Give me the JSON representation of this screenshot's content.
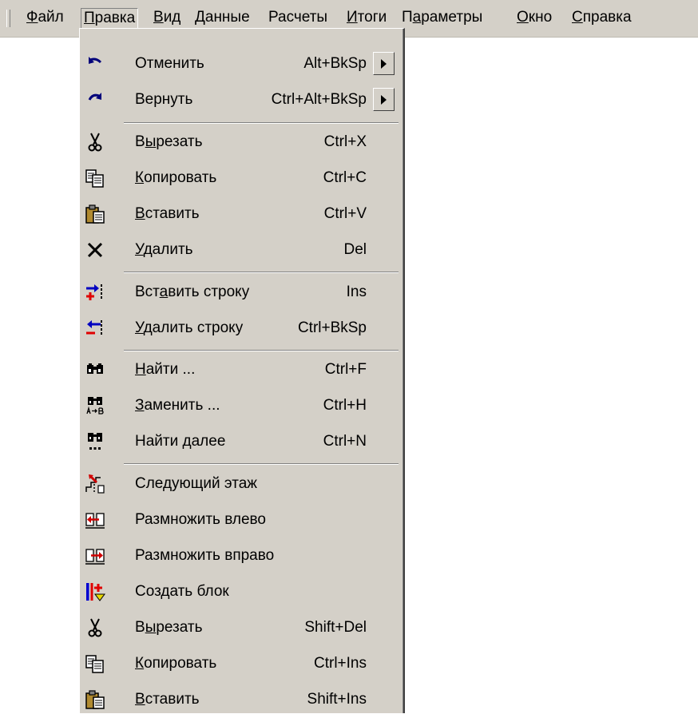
{
  "menubar": {
    "items": [
      {
        "pre": "",
        "acc": "Ф",
        "post": "айл"
      },
      {
        "pre": "",
        "acc": "П",
        "post": "равка"
      },
      {
        "pre": "",
        "acc": "В",
        "post": "ид"
      },
      {
        "pre": "",
        "acc": "Д",
        "post": "анные"
      },
      {
        "pre": "Расчеты",
        "acc": "",
        "post": ""
      },
      {
        "pre": "",
        "acc": "И",
        "post": "тоги"
      },
      {
        "pre": "П",
        "acc": "а",
        "post": "раметры"
      },
      {
        "pre": "",
        "acc": "О",
        "post": "кно"
      },
      {
        "pre": "",
        "acc": "С",
        "post": "правка"
      }
    ]
  },
  "edit_menu": {
    "items": [
      {
        "icon": "undo-icon",
        "pre": "Отменить",
        "acc": "",
        "post": "",
        "shortcut": "Alt+BkSp"
      },
      {
        "icon": "redo-icon",
        "pre": "Вернуть",
        "acc": "",
        "post": "",
        "shortcut": "Ctrl+Alt+BkSp"
      },
      {
        "icon": "scissors-icon",
        "pre": "В",
        "acc": "ы",
        "post": "резать",
        "shortcut": "Ctrl+X"
      },
      {
        "icon": "copy-icon",
        "pre": "",
        "acc": "К",
        "post": "опировать",
        "shortcut": "Ctrl+C"
      },
      {
        "icon": "paste-icon",
        "pre": "",
        "acc": "В",
        "post": "ставить",
        "shortcut": "Ctrl+V"
      },
      {
        "icon": "delete-x-icon",
        "pre": "",
        "acc": "У",
        "post": "далить",
        "shortcut": "Del"
      },
      {
        "icon": "insert-row-icon",
        "pre": "Вст",
        "acc": "а",
        "post": "вить строку",
        "shortcut": "Ins"
      },
      {
        "icon": "delete-row-icon",
        "pre": "",
        "acc": "У",
        "post": "далить строку",
        "shortcut": "Ctrl+BkSp"
      },
      {
        "icon": "binoculars-icon",
        "pre": "",
        "acc": "Н",
        "post": "айти ...",
        "shortcut": "Ctrl+F"
      },
      {
        "icon": "replace-binoculars-icon",
        "pre": "",
        "acc": "З",
        "post": "аменить ...",
        "shortcut": "Ctrl+H"
      },
      {
        "icon": "find-next-binoculars-icon",
        "pre": "Найти ",
        "acc": "д",
        "post": "алее",
        "shortcut": "Ctrl+N"
      },
      {
        "icon": "next-floor-icon",
        "pre": "Следующий этаж",
        "acc": "",
        "post": "",
        "shortcut": ""
      },
      {
        "icon": "multiply-left-icon",
        "pre": "Размножить влево",
        "acc": "",
        "post": "",
        "shortcut": ""
      },
      {
        "icon": "multiply-right-icon",
        "pre": "Размножить вправо",
        "acc": "",
        "post": "",
        "shortcut": ""
      },
      {
        "icon": "create-block-icon",
        "pre": "Создать блок",
        "acc": "",
        "post": "",
        "shortcut": ""
      },
      {
        "icon": "scissors-icon",
        "pre": "В",
        "acc": "ы",
        "post": "резать",
        "shortcut": "Shift+Del"
      },
      {
        "icon": "copy-icon",
        "pre": "",
        "acc": "К",
        "post": "опировать",
        "shortcut": "Ctrl+Ins"
      },
      {
        "icon": "paste-icon",
        "pre": "",
        "acc": "В",
        "post": "ставить",
        "shortcut": "Shift+Ins"
      }
    ]
  }
}
